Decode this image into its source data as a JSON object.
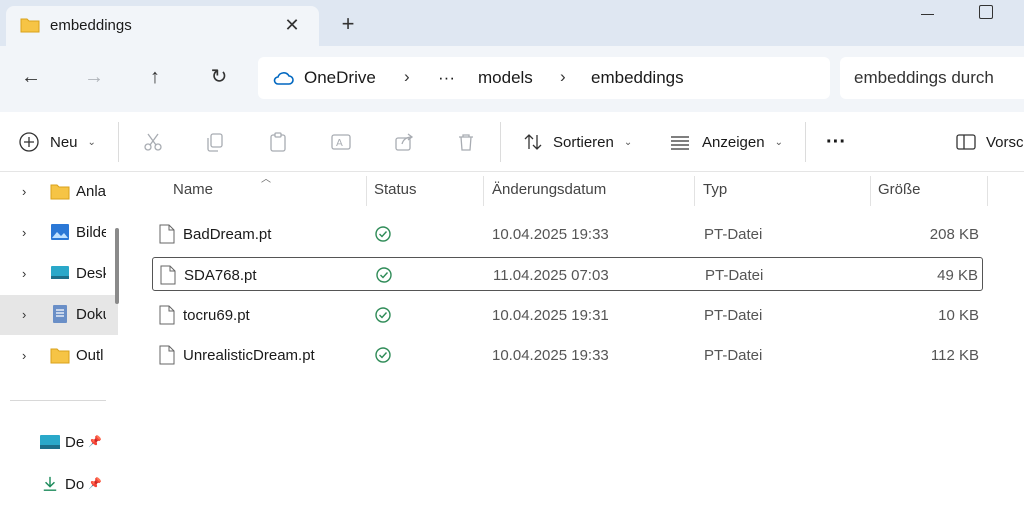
{
  "tab": {
    "title": "embeddings",
    "close_glyph": "✕",
    "new_tab_glyph": "+"
  },
  "nav": {
    "back_glyph": "←",
    "forward_glyph": "→",
    "up_glyph": "↑",
    "refresh_glyph": "↻"
  },
  "address": {
    "breadcrumbs": [
      "OneDrive",
      "···",
      "models",
      "embeddings"
    ],
    "separator": "›"
  },
  "search": {
    "placeholder": "embeddings durch"
  },
  "toolbar": {
    "new_label": "Neu",
    "sort_label": "Sortieren",
    "view_label": "Anzeigen",
    "more_glyph": "···",
    "preview_label": "Vorsc"
  },
  "sidebar": {
    "items": [
      {
        "label": "Anla",
        "icon": "folder-icon"
      },
      {
        "label": "Bilde",
        "icon": "pictures-icon"
      },
      {
        "label": "Desk",
        "icon": "desktop-icon"
      },
      {
        "label": "Doku",
        "icon": "documents-icon",
        "selected": true
      },
      {
        "label": "Outl",
        "icon": "folder-icon"
      }
    ],
    "quick_access": [
      {
        "label": "De",
        "icon": "desktop-icon"
      },
      {
        "label": "Do",
        "icon": "download-icon"
      }
    ],
    "chevron_glyph": "›",
    "pin_glyph": "📌"
  },
  "columns": {
    "name": "Name",
    "status": "Status",
    "date": "Änderungsdatum",
    "type": "Typ",
    "size": "Größe"
  },
  "files": [
    {
      "name": "BadDream.pt",
      "date": "10.04.2025 19:33",
      "type": "PT-Datei",
      "size": "208 KB"
    },
    {
      "name": "SDA768.pt",
      "date": "11.04.2025 07:03",
      "type": "PT-Datei",
      "size": "49 KB"
    },
    {
      "name": "tocru69.pt",
      "date": "10.04.2025 19:31",
      "type": "PT-Datei",
      "size": "10 KB"
    },
    {
      "name": "UnrealisticDream.pt",
      "date": "10.04.2025 19:33",
      "type": "PT-Datei",
      "size": "112 KB"
    }
  ],
  "colors": {
    "accent": "#0067c0",
    "status_ok": "#2e8b57",
    "folder": "#f6c445",
    "tabbar": "#dfe7f2"
  }
}
